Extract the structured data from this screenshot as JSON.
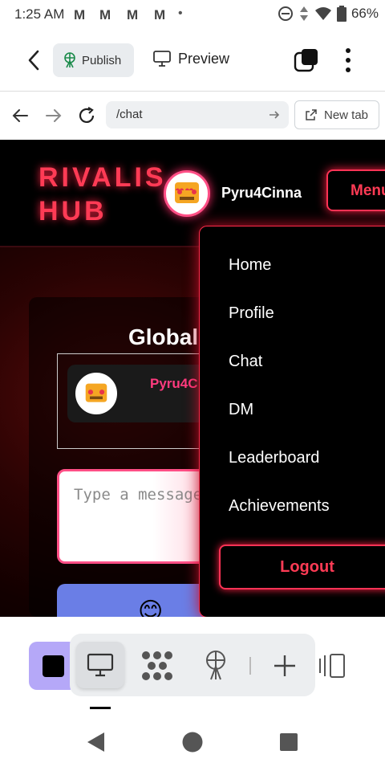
{
  "status_bar": {
    "time": "1:25 AM",
    "gmail_icons": [
      "M",
      "M",
      "M",
      "M"
    ],
    "dot": "•",
    "battery": "66%"
  },
  "toolbar": {
    "publish_label": "Publish",
    "preview_label": "Preview"
  },
  "url_bar": {
    "url": "/chat",
    "new_tab_label": "New tab"
  },
  "site": {
    "logo_line1": "RIVALIS",
    "logo_line2": "HUB",
    "username": "Pyru4Cinna",
    "menu_label": "Menu",
    "chat_title": "Global",
    "message_user": "Pyru4C",
    "input_placeholder": "Type a message",
    "emoji": "😊",
    "nav_items": [
      "Home",
      "Profile",
      "Chat",
      "DM",
      "Leaderboard",
      "Achievements"
    ],
    "logout_label": "Logout",
    "colors": {
      "neon_red": "#ff3b55",
      "pink": "#ff4f86",
      "emoji_bar": "#6a7ee6"
    }
  },
  "dock": {
    "icons": [
      "square-app-icon",
      "desktop-icon",
      "dots-grid-icon",
      "antenna-icon",
      "plus-icon",
      "columns-icon"
    ]
  }
}
